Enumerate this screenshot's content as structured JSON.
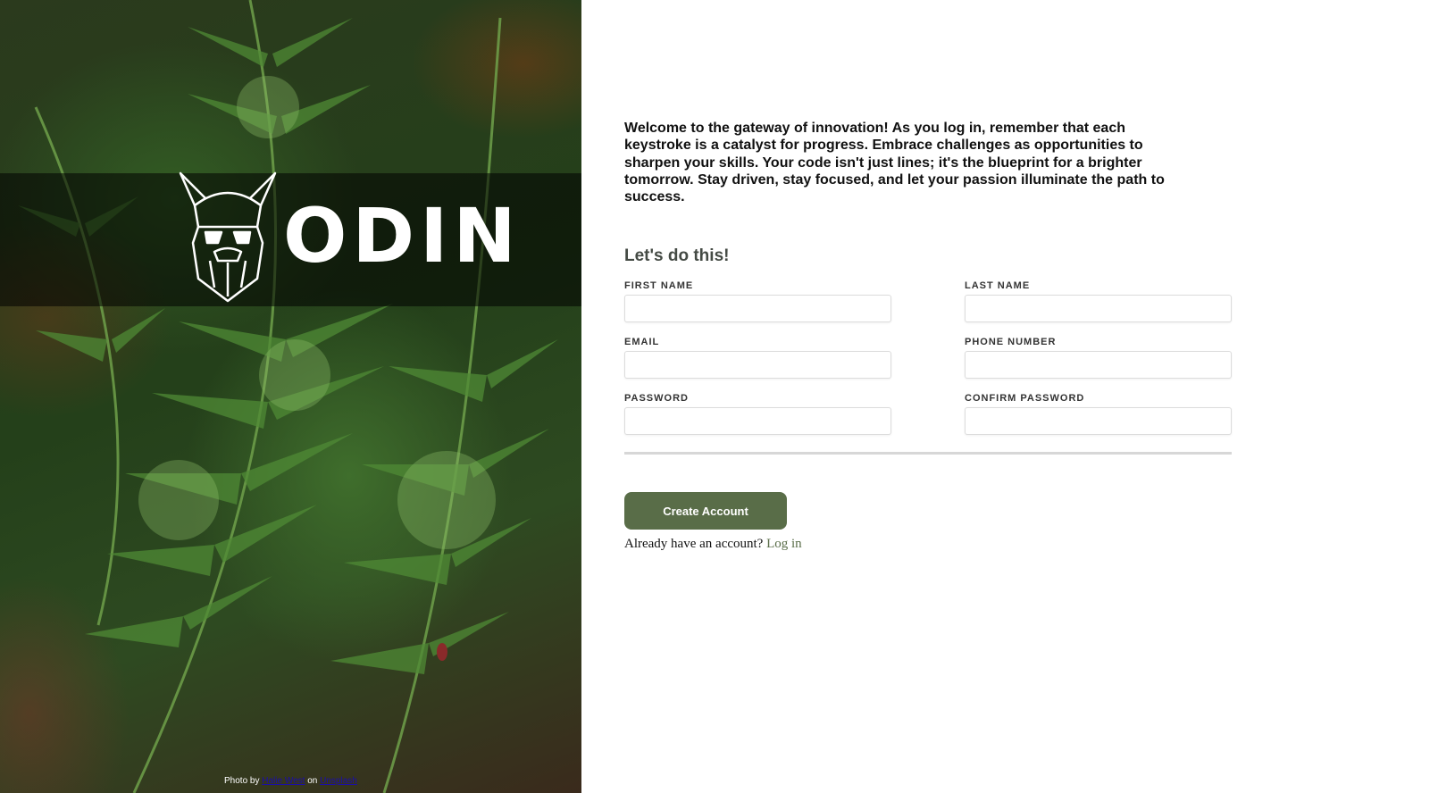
{
  "brand": {
    "name": "ODIN",
    "logo_icon": "viking-helmet-icon"
  },
  "photo_credit": {
    "prefix": "Photo by",
    "author": "Halie West",
    "middle": "on",
    "source": "Unsplash"
  },
  "intro_text": "Welcome to the gateway of innovation! As you log in, remember that each keystroke is a catalyst for progress. Embrace challenges as opportunities to sharpen your skills. Your code isn't just lines; it's the blueprint for a brighter tomorrow. Stay driven, stay focused, and let your passion illuminate the path to success.",
  "form": {
    "title": "Let's do this!",
    "fields": {
      "first_name": {
        "label": "FIRST NAME",
        "value": "",
        "placeholder": ""
      },
      "last_name": {
        "label": "LAST NAME",
        "value": "",
        "placeholder": ""
      },
      "email": {
        "label": "EMAIL",
        "value": "",
        "placeholder": ""
      },
      "phone": {
        "label": "PHONE NUMBER",
        "value": "",
        "placeholder": ""
      },
      "password": {
        "label": "PASSWORD",
        "value": "",
        "placeholder": ""
      },
      "confirm_password": {
        "label": "CONFIRM PASSWORD",
        "value": "",
        "placeholder": ""
      }
    },
    "submit_label": "Create Account",
    "login_prompt": "Already have an account?",
    "login_link": "Log in"
  },
  "colors": {
    "accent": "#596d48",
    "page_background": "#ffffff",
    "logo_band": "#000000"
  }
}
